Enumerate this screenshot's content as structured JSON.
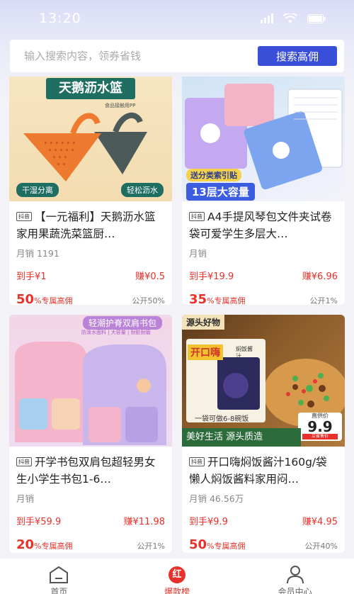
{
  "status": {
    "time": "13:20"
  },
  "search": {
    "placeholder": "输入搜索内容，领券省钱",
    "button": "搜索高佣"
  },
  "products": [
    {
      "banner": "天鹅沥水篮",
      "material": "食品接触用PP",
      "tag_left": "干湿分离",
      "tag_right": "轻松沥水",
      "platform": "抖音",
      "title": "【一元福利】天鹅沥水篮家用果蔬洗菜篮厨…",
      "sales": "月销 1191",
      "price": "到手¥1",
      "earn": "赚¥0.5",
      "rate": "50",
      "rate_suffix": "%专属高佣",
      "public": "公开50%"
    },
    {
      "promo": "送分类索引贴",
      "capacity": "13层大容量",
      "platform": "抖音",
      "title": "A4手提风琴包文件夹试卷袋可爱学生多层大…",
      "sales": "月销",
      "price": "到手¥19.9",
      "earn": "赚¥6.96",
      "rate": "35",
      "rate_suffix": "%专属高佣",
      "public": "公开1%"
    },
    {
      "banner": "轻潮护脊双肩书包",
      "features": "防泼水面料 | 大容量 | 耐脏耐磨",
      "platform": "抖音",
      "title": "开学书包双肩包超轻男女生小学生书包1-6…",
      "sales": "月销",
      "price": "到手¥59.9",
      "earn": "赚¥11.98",
      "rate": "20",
      "rate_suffix": "%专属高佣",
      "public": "公开1%"
    },
    {
      "corner": "源头好物",
      "brand": "开口嗨",
      "pack_label": "焖饭酱汁",
      "serving": "一袋可做6-8碗饭",
      "slogan": "美好生活 源头质造",
      "price_label": "直供价",
      "price_big": "9.9",
      "price_note": "立省售价",
      "platform": "抖音",
      "title": "开口嗨焖饭酱汁160g/袋懒人焖饭酱料家用闷…",
      "sales": "月销 46.56万",
      "price": "到手¥9.9",
      "earn": "赚¥4.95",
      "rate": "50",
      "rate_suffix": "%专属高佣",
      "public": "公开40%"
    }
  ],
  "tabs": [
    {
      "label": "首页",
      "icon": "home-icon"
    },
    {
      "label": "爆款榜",
      "icon": "hot-list-icon",
      "badge": "红"
    },
    {
      "label": "会员中心",
      "icon": "profile-icon"
    }
  ],
  "colors": {
    "accent": "#e8312a",
    "search_button": "#3a4fd8"
  }
}
